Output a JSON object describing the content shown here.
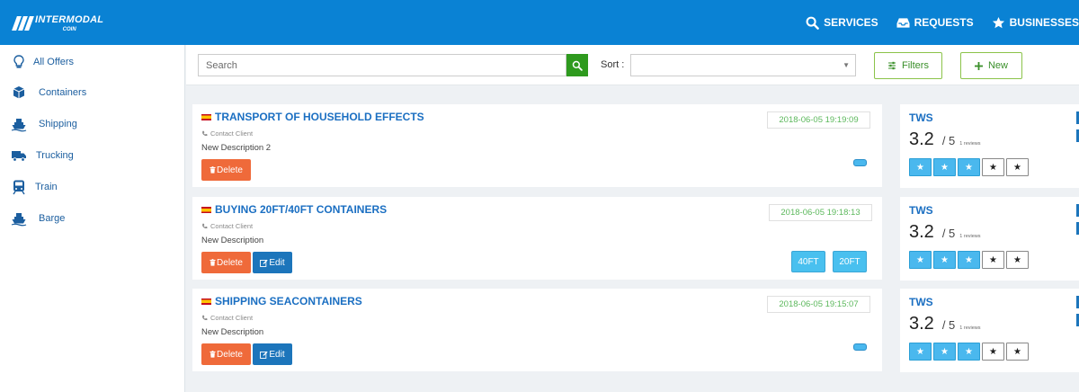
{
  "brand": {
    "line1": "INTERMODAL",
    "line2": "COIN"
  },
  "nav": [
    {
      "label": "SERVICES",
      "icon": "search-icon"
    },
    {
      "label": "REQUESTS",
      "icon": "inbox-icon"
    },
    {
      "label": "BUSINESSES",
      "icon": "star-icon"
    }
  ],
  "sidebar": {
    "items": [
      {
        "label": "All Offers",
        "icon": "lightbulb-icon"
      },
      {
        "label": "Containers",
        "icon": "cube-icon"
      },
      {
        "label": "Shipping",
        "icon": "ship-icon"
      },
      {
        "label": "Trucking",
        "icon": "truck-icon"
      },
      {
        "label": "Train",
        "icon": "train-icon"
      },
      {
        "label": "Barge",
        "icon": "barge-icon"
      }
    ]
  },
  "toolbar": {
    "search_placeholder": "Search",
    "sort_label": "Sort :",
    "sort_value": "",
    "filters_label": "Filters",
    "new_label": "New"
  },
  "offers": [
    {
      "title": "TRANSPORT OF HOUSEHOLD EFFECTS",
      "contact": "Contact Client",
      "description": "New Description 2",
      "date": "2018-06-05 19:19:09",
      "delete_label": "Delete",
      "edit_label": "",
      "tags": []
    },
    {
      "title": "BUYING 20FT/40FT CONTAINERS",
      "contact": "Contact Client",
      "description": "New Description",
      "date": "2018-06-05 19:18:13",
      "delete_label": "Delete",
      "edit_label": "Edit",
      "tags": [
        "40FT",
        "20FT"
      ]
    },
    {
      "title": "SHIPPING SEACONTAINERS",
      "contact": "Contact Client",
      "description": "New Description",
      "date": "2018-06-05 19:15:07",
      "delete_label": "Delete",
      "edit_label": "Edit",
      "tags": []
    }
  ],
  "ratings": [
    {
      "name": "TWS",
      "score": "3.2",
      "out_of": "/ 5",
      "reviews": "1 reviews",
      "stars": 3,
      "max_stars": 5
    },
    {
      "name": "TWS",
      "score": "3.2",
      "out_of": "/ 5",
      "reviews": "1 reviews",
      "stars": 3,
      "max_stars": 5
    },
    {
      "name": "TWS",
      "score": "3.2",
      "out_of": "/ 5",
      "reviews": "1 reviews",
      "stars": 3,
      "max_stars": 5
    }
  ],
  "star_glyph": "★",
  "colors": {
    "brand_blue": "#0a82d4",
    "delete": "#ef6a3a",
    "edit": "#1c75bb",
    "accent_green": "#2e9a1e",
    "tag": "#49c0ef"
  }
}
